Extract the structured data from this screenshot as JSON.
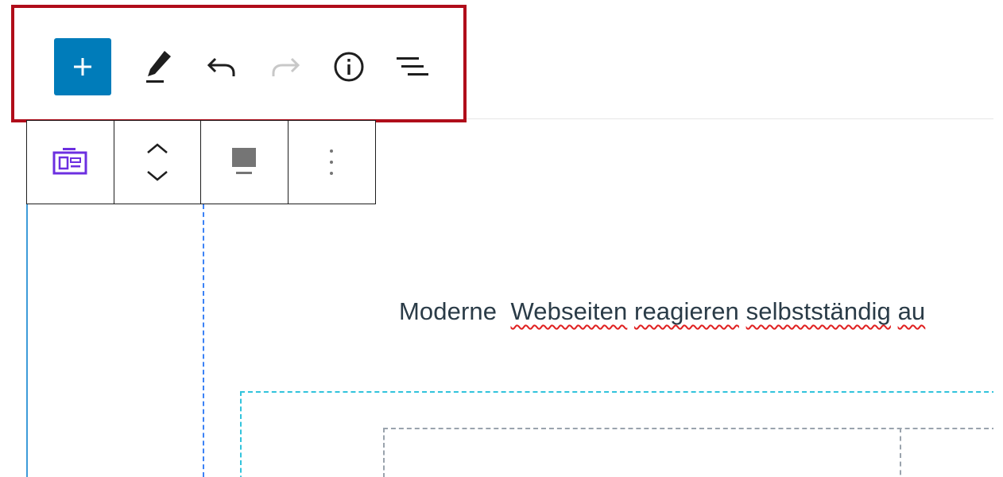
{
  "toolbar": {
    "buttons": [
      {
        "name": "add-block",
        "icon": "plus-icon",
        "state": "active"
      },
      {
        "name": "tools",
        "icon": "pencil-icon",
        "state": "enabled"
      },
      {
        "name": "undo",
        "icon": "undo-icon",
        "state": "enabled"
      },
      {
        "name": "redo",
        "icon": "redo-icon",
        "state": "disabled"
      },
      {
        "name": "details",
        "icon": "info-icon",
        "state": "enabled"
      },
      {
        "name": "list-view",
        "icon": "list-view-icon",
        "state": "enabled"
      }
    ]
  },
  "block_toolbar": {
    "items": [
      {
        "name": "block-type",
        "icon": "media-text-icon"
      },
      {
        "name": "move",
        "icon": "move-up-down-icon"
      },
      {
        "name": "align",
        "icon": "align-icon"
      },
      {
        "name": "options",
        "icon": "more-vertical-icon"
      }
    ]
  },
  "content": {
    "paragraph_start": "Moderne  ",
    "paragraph_words": [
      "Webseiten",
      "reagieren",
      "selbstständig",
      "au"
    ],
    "paragraph_spaces": [
      " ",
      " ",
      " "
    ]
  },
  "colors": {
    "accent": "#007cba",
    "highlight_border": "#b00d1a",
    "block_icon": "#6c2fe0",
    "text": "#2a3b47",
    "spellcheck": "#e02020",
    "group_outline": "#31c3dc",
    "column_outline": "#9aa3ad",
    "selected_outline": "#3d9bd9"
  }
}
